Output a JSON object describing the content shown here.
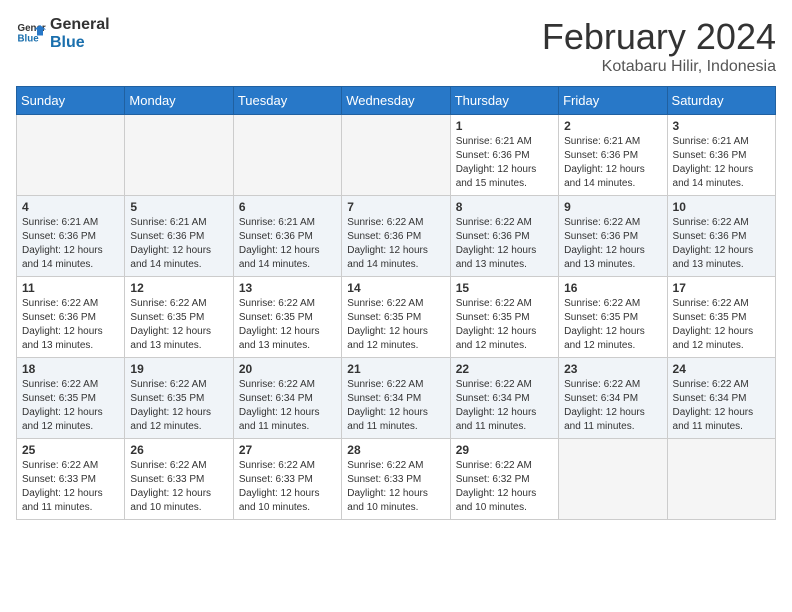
{
  "logo": {
    "line1": "General",
    "line2": "Blue"
  },
  "title": "February 2024",
  "subtitle": "Kotabaru Hilir, Indonesia",
  "weekdays": [
    "Sunday",
    "Monday",
    "Tuesday",
    "Wednesday",
    "Thursday",
    "Friday",
    "Saturday"
  ],
  "weeks": [
    [
      {
        "day": "",
        "info": ""
      },
      {
        "day": "",
        "info": ""
      },
      {
        "day": "",
        "info": ""
      },
      {
        "day": "",
        "info": ""
      },
      {
        "day": "1",
        "info": "Sunrise: 6:21 AM\nSunset: 6:36 PM\nDaylight: 12 hours\nand 15 minutes."
      },
      {
        "day": "2",
        "info": "Sunrise: 6:21 AM\nSunset: 6:36 PM\nDaylight: 12 hours\nand 14 minutes."
      },
      {
        "day": "3",
        "info": "Sunrise: 6:21 AM\nSunset: 6:36 PM\nDaylight: 12 hours\nand 14 minutes."
      }
    ],
    [
      {
        "day": "4",
        "info": "Sunrise: 6:21 AM\nSunset: 6:36 PM\nDaylight: 12 hours\nand 14 minutes."
      },
      {
        "day": "5",
        "info": "Sunrise: 6:21 AM\nSunset: 6:36 PM\nDaylight: 12 hours\nand 14 minutes."
      },
      {
        "day": "6",
        "info": "Sunrise: 6:21 AM\nSunset: 6:36 PM\nDaylight: 12 hours\nand 14 minutes."
      },
      {
        "day": "7",
        "info": "Sunrise: 6:22 AM\nSunset: 6:36 PM\nDaylight: 12 hours\nand 14 minutes."
      },
      {
        "day": "8",
        "info": "Sunrise: 6:22 AM\nSunset: 6:36 PM\nDaylight: 12 hours\nand 13 minutes."
      },
      {
        "day": "9",
        "info": "Sunrise: 6:22 AM\nSunset: 6:36 PM\nDaylight: 12 hours\nand 13 minutes."
      },
      {
        "day": "10",
        "info": "Sunrise: 6:22 AM\nSunset: 6:36 PM\nDaylight: 12 hours\nand 13 minutes."
      }
    ],
    [
      {
        "day": "11",
        "info": "Sunrise: 6:22 AM\nSunset: 6:36 PM\nDaylight: 12 hours\nand 13 minutes."
      },
      {
        "day": "12",
        "info": "Sunrise: 6:22 AM\nSunset: 6:35 PM\nDaylight: 12 hours\nand 13 minutes."
      },
      {
        "day": "13",
        "info": "Sunrise: 6:22 AM\nSunset: 6:35 PM\nDaylight: 12 hours\nand 13 minutes."
      },
      {
        "day": "14",
        "info": "Sunrise: 6:22 AM\nSunset: 6:35 PM\nDaylight: 12 hours\nand 12 minutes."
      },
      {
        "day": "15",
        "info": "Sunrise: 6:22 AM\nSunset: 6:35 PM\nDaylight: 12 hours\nand 12 minutes."
      },
      {
        "day": "16",
        "info": "Sunrise: 6:22 AM\nSunset: 6:35 PM\nDaylight: 12 hours\nand 12 minutes."
      },
      {
        "day": "17",
        "info": "Sunrise: 6:22 AM\nSunset: 6:35 PM\nDaylight: 12 hours\nand 12 minutes."
      }
    ],
    [
      {
        "day": "18",
        "info": "Sunrise: 6:22 AM\nSunset: 6:35 PM\nDaylight: 12 hours\nand 12 minutes."
      },
      {
        "day": "19",
        "info": "Sunrise: 6:22 AM\nSunset: 6:35 PM\nDaylight: 12 hours\nand 12 minutes."
      },
      {
        "day": "20",
        "info": "Sunrise: 6:22 AM\nSunset: 6:34 PM\nDaylight: 12 hours\nand 11 minutes."
      },
      {
        "day": "21",
        "info": "Sunrise: 6:22 AM\nSunset: 6:34 PM\nDaylight: 12 hours\nand 11 minutes."
      },
      {
        "day": "22",
        "info": "Sunrise: 6:22 AM\nSunset: 6:34 PM\nDaylight: 12 hours\nand 11 minutes."
      },
      {
        "day": "23",
        "info": "Sunrise: 6:22 AM\nSunset: 6:34 PM\nDaylight: 12 hours\nand 11 minutes."
      },
      {
        "day": "24",
        "info": "Sunrise: 6:22 AM\nSunset: 6:34 PM\nDaylight: 12 hours\nand 11 minutes."
      }
    ],
    [
      {
        "day": "25",
        "info": "Sunrise: 6:22 AM\nSunset: 6:33 PM\nDaylight: 12 hours\nand 11 minutes."
      },
      {
        "day": "26",
        "info": "Sunrise: 6:22 AM\nSunset: 6:33 PM\nDaylight: 12 hours\nand 10 minutes."
      },
      {
        "day": "27",
        "info": "Sunrise: 6:22 AM\nSunset: 6:33 PM\nDaylight: 12 hours\nand 10 minutes."
      },
      {
        "day": "28",
        "info": "Sunrise: 6:22 AM\nSunset: 6:33 PM\nDaylight: 12 hours\nand 10 minutes."
      },
      {
        "day": "29",
        "info": "Sunrise: 6:22 AM\nSunset: 6:32 PM\nDaylight: 12 hours\nand 10 minutes."
      },
      {
        "day": "",
        "info": ""
      },
      {
        "day": "",
        "info": ""
      }
    ]
  ]
}
